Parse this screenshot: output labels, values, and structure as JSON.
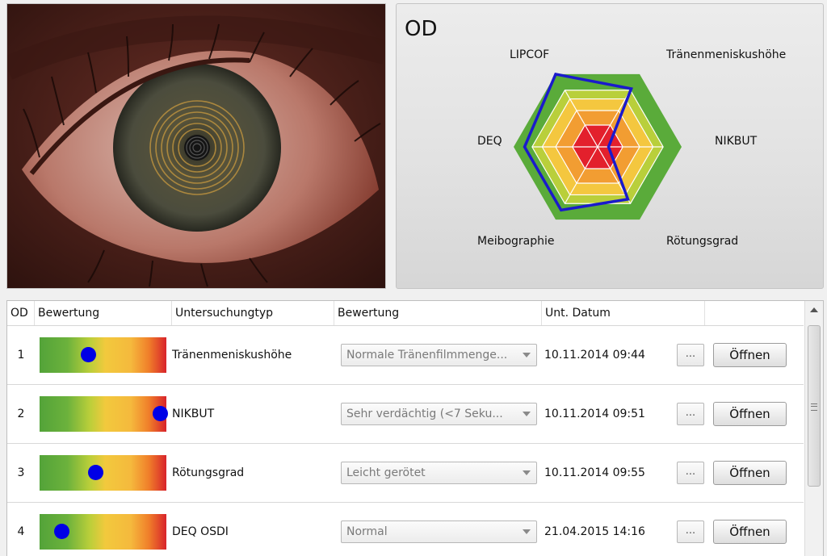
{
  "radar": {
    "title": "OD",
    "axes": [
      "LIPCOF",
      "Tränenmeniskushöhe",
      "NIKBUT",
      "Rötungsgrad",
      "Meibographie",
      "DEQ"
    ],
    "values": [
      1.0,
      0.8,
      0.13,
      0.72,
      0.87,
      0.87
    ],
    "colors": {
      "green": "#5aab3a",
      "yellow": "#f4c73f",
      "orange": "#f29d32",
      "red": "#e3202c",
      "line": "#1a1acc"
    }
  },
  "table": {
    "headers": [
      "OD",
      "Bewertung",
      "Untersuchungtyp",
      "Bewertung",
      "Unt. Datum"
    ],
    "rows": [
      {
        "num": "1",
        "gauge": 0.38,
        "type": "Tränenmeniskushöhe",
        "rating": "Normale Tränenfilmmenge...",
        "date": "10.11.2014 09:44",
        "more": "...",
        "open": "Öffnen"
      },
      {
        "num": "2",
        "gauge": 0.95,
        "type": "NIKBUT",
        "rating": "Sehr verdächtig (<7 Seku...",
        "date": "10.11.2014 09:51",
        "more": "...",
        "open": "Öffnen"
      },
      {
        "num": "3",
        "gauge": 0.44,
        "type": "Rötungsgrad",
        "rating": "Leicht gerötet",
        "date": "10.11.2014 09:55",
        "more": "...",
        "open": "Öffnen"
      },
      {
        "num": "4",
        "gauge": 0.17,
        "type": "DEQ OSDI",
        "rating": "Normal",
        "date": "21.04.2015 14:16",
        "more": "...",
        "open": "Öffnen"
      }
    ]
  }
}
